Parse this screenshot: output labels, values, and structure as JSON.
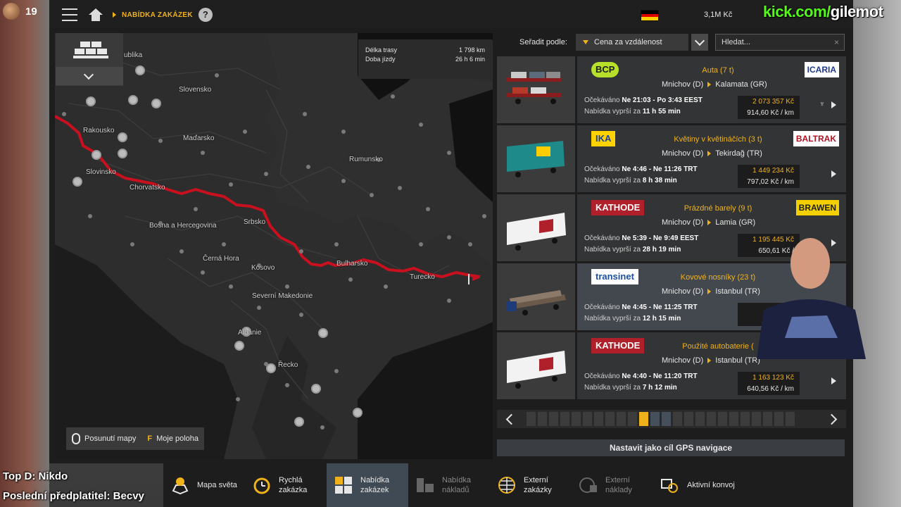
{
  "stream": {
    "viewers": "19",
    "kick_prefix": "kick.com/",
    "kick_user": "gilemot",
    "top_d": "Top D: Nikdo",
    "last_sub": "Poslední předplatitel: Becvy"
  },
  "header": {
    "breadcrumb": "NABÍDKA ZAKÁZEK",
    "help": "?",
    "money": "3,1M  Kč",
    "flag_colors": [
      "#000000",
      "#dd0000",
      "#ffce00"
    ]
  },
  "map": {
    "route_length_label": "Délka trasy",
    "route_length_value": "1 798 km",
    "drive_time_label": "Doba jízdy",
    "drive_time_value": "26 h 6 min",
    "labels": [
      "ublika",
      "Slovensko",
      "Rakousko",
      "Maďarsko",
      "Rumunsko",
      "Slovinsko",
      "Chorvatsko",
      "Bosna a Hercegovina",
      "Srbsko",
      "Černá Hora",
      "Kosovo",
      "Bulharsko",
      "Turecko",
      "Severní Makedonie",
      "Albánie",
      "Řecko"
    ],
    "pan_label": "Posunutí mapy",
    "position_key": "F",
    "position_label": "Moje poloha",
    "route_color": "#c8101e"
  },
  "sort": {
    "label": "Seřadit podle:",
    "selected": "Cena za vzdálenost",
    "search_placeholder": "Hledat...",
    "clear": "×"
  },
  "jobs": [
    {
      "company": "BCP",
      "cargo": "Auta (7 t)",
      "client": "ICARIA",
      "from": "Mnichov (D)",
      "to": "Kalamata (GR)",
      "expected_label": "Očekáváno",
      "expected": "Ne 21:03 - Po 3:43 EEST",
      "expires_label": "Nabídka vyprší za",
      "expires": "11 h 55 min",
      "price": "2 073 357 Kč",
      "per_km": "914,60 Kč / km",
      "mini": "♆"
    },
    {
      "company": "IKA",
      "cargo": "Květiny v květináčích (3 t)",
      "client": "BALTRAK",
      "from": "Mnichov (D)",
      "to": "Tekirdağ (TR)",
      "expected_label": "Očekáváno",
      "expected": "Ne 4:46 - Ne 11:26 TRT",
      "expires_label": "Nabídka vyprší za",
      "expires": "8 h 38 min",
      "price": "1 449 234 Kč",
      "per_km": "797,02 Kč / km",
      "mini": ""
    },
    {
      "company": "KATHODE",
      "cargo": "Prázdné barely (9 t)",
      "client": "BRAWEN",
      "from": "Mnichov (D)",
      "to": "Lamia (GR)",
      "expected_label": "Očekáváno",
      "expected": "Ne 5:39 - Ne 9:49 EEST",
      "expires_label": "Nabídka vyprší za",
      "expires": "28 h 19 min",
      "price": "1 195 445 Kč",
      "per_km": "650,61 Kč /",
      "mini": ""
    },
    {
      "company": "transinet",
      "cargo": "Kovové nosníky (23 t)",
      "client": "",
      "from": "Mnichov (D)",
      "to": "Istanbul (TR)",
      "expected_label": "Očekáváno",
      "expected": "Ne 4:45 - Ne 11:25 TRT",
      "expires_label": "Nabídka vyprší za",
      "expires": "12 h 15 min",
      "price": "1",
      "per_km": "",
      "mini": ""
    },
    {
      "company": "KATHODE",
      "cargo": "Použité autobaterie (",
      "client": "",
      "from": "Mnichov (D)",
      "to": "Istanbul (TR)",
      "expected_label": "Očekáváno",
      "expected": "Ne 4:40 - Ne 11:20 TRT",
      "expires_label": "Nabídka vyprší za",
      "expires": "7 h 12 min",
      "price": "1 163 123 Kč",
      "per_km": "640,56 Kč / km",
      "mini": ""
    }
  ],
  "gps_button": "Nastavit jako cíl GPS navigace",
  "nav": [
    {
      "label": "Mapa světa",
      "icon": "map-pin-icon"
    },
    {
      "label": "Rychlá zakázka",
      "icon": "stopwatch-icon"
    },
    {
      "label": "Nabídka zakázek",
      "icon": "grid-icon"
    },
    {
      "label": "Nabídka nákladů",
      "icon": "cargo-icon"
    },
    {
      "label": "Externí zakázky",
      "icon": "globe-icon"
    },
    {
      "label": "Externí náklady",
      "icon": "globe-cargo-icon"
    },
    {
      "label": "Aktivní konvoj",
      "icon": "convoy-icon"
    }
  ],
  "accent": "#f0b21b"
}
